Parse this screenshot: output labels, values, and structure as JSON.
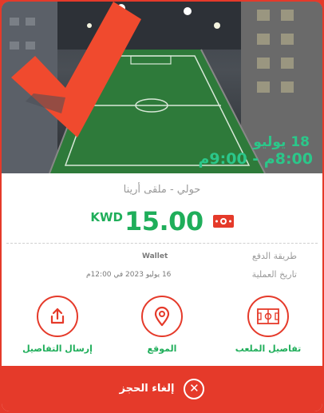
{
  "booking": {
    "date": "18 يوليو",
    "time": "8:00م - 9:00م",
    "venue": "حولي - ملقى أرينا",
    "currency": "KWD",
    "amount": "15.00"
  },
  "details": {
    "payment_method_label": "طريقة الدفع",
    "payment_method_value": "Wallet",
    "transaction_date_label": "تاريخ العملية",
    "transaction_date_value": "16 يوليو 2023 في 12:00م"
  },
  "actions": {
    "field_details": "تفاصيل الملعب",
    "location": "الموقع",
    "send_details": "إرسال التفاصيل"
  },
  "cancel": {
    "label": "إلغاء الحجز"
  },
  "colors": {
    "brand_red": "#e53a2a",
    "accent_green": "#1fae5a",
    "time_green": "#2bc78a"
  },
  "icons": {
    "check": "check-mark-icon",
    "cash": "cash-icon",
    "field": "stadium-icon",
    "location": "map-pin-icon",
    "share": "share-upload-icon",
    "cancel": "close-circle-icon"
  }
}
